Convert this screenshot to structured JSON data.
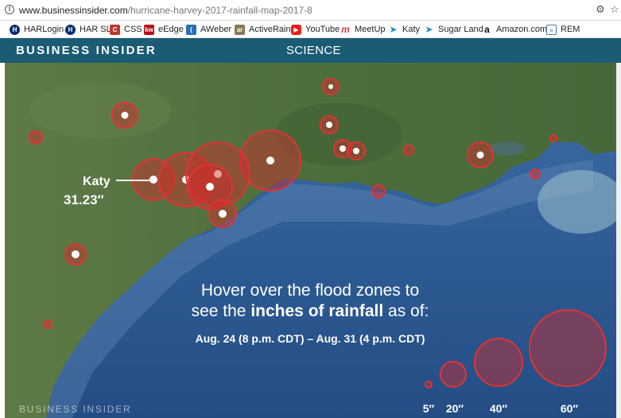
{
  "browser": {
    "url_domain": "www.businessinsider.com",
    "url_path": "/hurricane-harvey-2017-rainfall-map-2017-8"
  },
  "bookmarks": [
    {
      "label": "HARLogin",
      "icon": "har-icon",
      "color": "#0a2d6e"
    },
    {
      "label": "HAR SL",
      "icon": "har-icon",
      "color": "#0a2d6e"
    },
    {
      "label": "CSS",
      "icon": "css-icon",
      "color": "#c0392b"
    },
    {
      "label": "eEdge",
      "icon": "kw-icon",
      "color": "#b5121b"
    },
    {
      "label": "AWeber",
      "icon": "aweber-icon",
      "color": "#2a6fb5"
    },
    {
      "label": "ActiveRain",
      "icon": "activerain-icon",
      "color": "#8a7a52"
    },
    {
      "label": "YouTube",
      "icon": "youtube-icon",
      "color": "#e62117"
    },
    {
      "label": "MeetUp",
      "icon": "meetup-icon",
      "color": "#e0393e"
    },
    {
      "label": "Katy",
      "icon": "feather-icon",
      "color": "#1f8fc7"
    },
    {
      "label": "Sugar Land",
      "icon": "feather-icon",
      "color": "#1f8fc7"
    },
    {
      "label": "Amazon.com",
      "icon": "amazon-icon",
      "color": "#111111"
    },
    {
      "label": "REM",
      "icon": "doc-icon",
      "color": "#4a78b5"
    }
  ],
  "header": {
    "logo": "BUSINESS INSIDER",
    "section": "SCIENCE",
    "bg_color": "#1b5b74"
  },
  "map": {
    "callout_city": "Katy",
    "callout_value": "31.23″",
    "instruction_line1": "Hover over the flood zones to",
    "instruction_line2_pre": "see the ",
    "instruction_line2_bold": "inches of rainfall",
    "instruction_line2_post": " as of:",
    "date_range": "Aug. 24 (8 p.m. CDT) – Aug. 31 (4 p.m. CDT)",
    "watermark": "BUSINESS INSIDER",
    "zone_color": "#d42a2a",
    "legend": [
      "5″",
      "20″",
      "40″",
      "60″"
    ]
  }
}
